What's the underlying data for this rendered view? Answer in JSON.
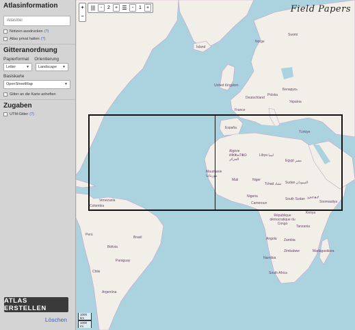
{
  "sidebar": {
    "atlas_info": {
      "heading": "Atlasinformation",
      "title_placeholder": "Atlastitel",
      "notes_label": "Notizen ausdrucken",
      "notes_help": "(?)",
      "private_label": "Atlas privat halten",
      "private_help": "(?)"
    },
    "grid": {
      "heading": "Gitteranordnung",
      "paper_format_label": "Papierformat",
      "orientation_label": "Orientierung",
      "paper_format_value": "Letter",
      "orientation_value": "Landscape",
      "basemap_label": "Basiskarte",
      "basemap_value": "OpenStreetMap",
      "fit_label": "Gitter an die Karte anheften"
    },
    "extras": {
      "heading": "Zugaben",
      "utm_label": "UTM-Gitter",
      "utm_help": "(?)"
    },
    "create_button": "ATLAS ERSTELLEN",
    "delete_link": "Löschen"
  },
  "map": {
    "logo": "Field Papers",
    "zoom_in": "+",
    "zoom_out": "−",
    "cols_icon": "columns-icon",
    "cols_minus": "-",
    "cols_value": "2",
    "cols_plus": "+",
    "rows_icon": "rows-icon",
    "rows_minus": "-",
    "rows_value": "1",
    "rows_plus": "+",
    "scale_km": "1000 km",
    "scale_mi": "1000 mi",
    "labels": {
      "norge": "Norge",
      "suomi": "Suomi",
      "island": "Ísland",
      "uk": "United Kingdom",
      "polska": "Polska",
      "belarus": "Беларусь",
      "ukraine": "Україна",
      "deutschland": "Deutschland",
      "france": "France",
      "espana": "España",
      "turkiye": "Türkiye",
      "algerie": "Algérie ⵍⵣⵣⴰⵢⴻⵔ الجزائر",
      "libya": "Libya ليبيا",
      "egypt": "Egypt مصر",
      "mauritanie": "Mauritanie موريتانيا",
      "mali": "Mali",
      "niger": "Niger",
      "tchad": "Tchad تشاد",
      "sudan": "Sudan السودان",
      "nigeria": "Nigeria",
      "cameroun": "Cameroun",
      "south_sudan": "South Sudan",
      "ethiopia": "ኢትዮጵያ",
      "soomaaliya": "Soomaaliya",
      "venezuela": "Venezuela",
      "colombia": "Colombia",
      "peru": "Perú",
      "brasil": "Brasil",
      "bolivia": "Bolivia",
      "paraguay": "Paraguay",
      "chile": "Chile",
      "argentina": "Argentina",
      "rdc": "République démocratique du Congo",
      "kenya": "Kenya",
      "tanzania": "Tanzania",
      "angola": "Angola",
      "zambia": "Zambia",
      "namibia": "Namibia",
      "zimbabwe": "Zimbabwe",
      "south_africa": "South Africa",
      "madagasikara": "Madagasikara"
    }
  }
}
